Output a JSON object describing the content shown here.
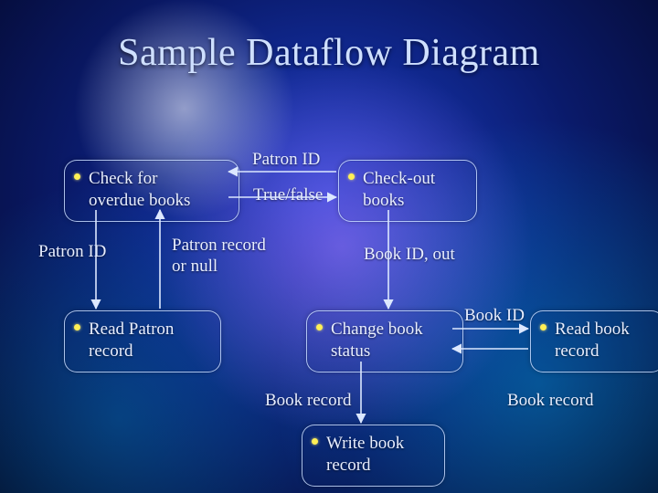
{
  "title": "Sample Dataflow Diagram",
  "nodes": {
    "check_overdue": "Check for\n overdue books",
    "check_out": "Check-out\nbooks",
    "read_patron": "Read Patron\nrecord",
    "change_status": "Change book\nstatus",
    "read_book": "Read book\n record",
    "write_book": "Write book\n record"
  },
  "labels": {
    "patron_id_top": "Patron ID",
    "true_false": "True/false",
    "patron_id_left": "Patron ID",
    "patron_record_or_null": "Patron record\nor null",
    "book_id_out": "Book ID, out",
    "book_id": "Book ID",
    "book_record_left": "Book record",
    "book_record_right": "Book record"
  }
}
